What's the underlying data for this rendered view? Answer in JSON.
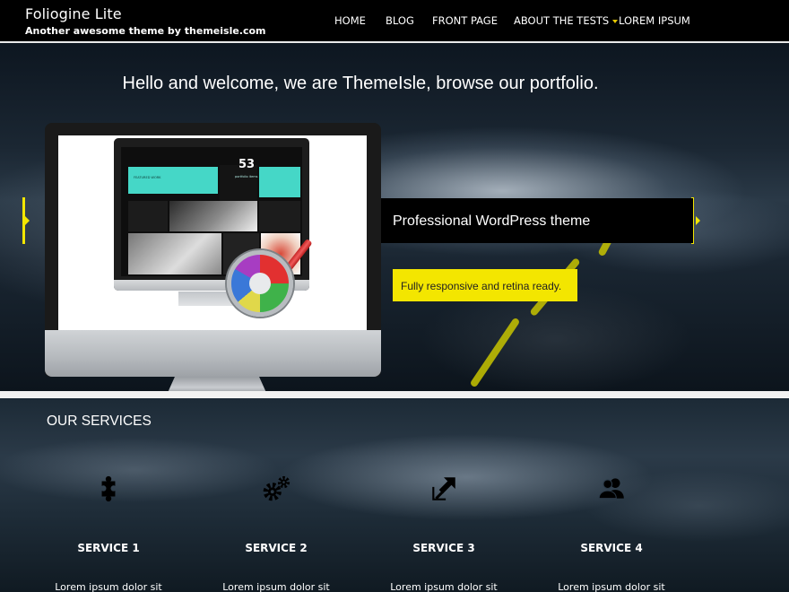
{
  "site": {
    "title": "Foliogine Lite",
    "description": "Another awesome theme by themeisle.com"
  },
  "nav": {
    "items": [
      {
        "label": "HOME",
        "has_submenu": false
      },
      {
        "label": "BLOG",
        "has_submenu": false
      },
      {
        "label": "FRONT PAGE",
        "has_submenu": false
      },
      {
        "label": "ABOUT THE TESTS",
        "has_submenu": true
      },
      {
        "label": "LOREM IPSUM",
        "has_submenu": false
      }
    ]
  },
  "hero": {
    "heading": "Hello and welcome, we are ThemeIsle, browse our portfolio.",
    "slide": {
      "title": "Professional WordPress theme",
      "button_label": "Fully responsive and retina ready."
    },
    "mockup": {
      "count": "53",
      "count_label": "portfolio items",
      "featured_label": "FEATURED WORK"
    }
  },
  "services": {
    "title": "OUR SERVICES",
    "items": [
      {
        "name": "SERVICE 1",
        "icon": "puzzle-icon",
        "text": "Lorem ipsum dolor sit"
      },
      {
        "name": "SERVICE 2",
        "icon": "gears-icon",
        "text": "Lorem ipsum dolor sit"
      },
      {
        "name": "SERVICE 3",
        "icon": "expand-arrows-icon",
        "text": "Lorem ipsum dolor sit"
      },
      {
        "name": "SERVICE 4",
        "icon": "users-icon",
        "text": "Lorem ipsum dolor sit"
      }
    ]
  },
  "colors": {
    "accent": "#f3e600",
    "header_bg": "#000000",
    "mockup_teal": "#45d7c7"
  }
}
